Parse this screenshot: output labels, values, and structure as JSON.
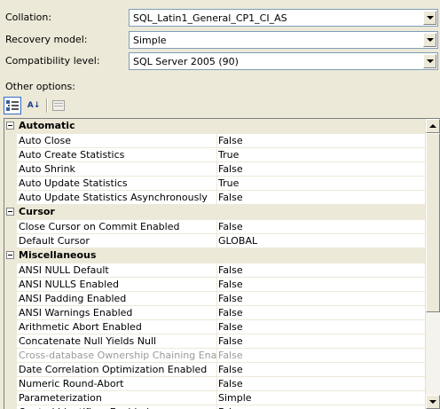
{
  "fields": {
    "collation": {
      "label": "Collation:",
      "value": "SQL_Latin1_General_CP1_CI_AS"
    },
    "recovery_model": {
      "label": "Recovery model:",
      "value": "Simple"
    },
    "compatibility_level": {
      "label": "Compatibility level:",
      "value": "SQL Server 2005 (90)"
    }
  },
  "other_options_label": "Other options:",
  "toolbar": {
    "categorized": {
      "icon": "categorized-icon"
    },
    "alphabetical": {
      "icon": "sort-az-icon",
      "glyph": "A↓"
    },
    "property_pages": {
      "icon": "property-pages-icon"
    }
  },
  "grid": {
    "categories": [
      {
        "label": "Automatic",
        "rows": [
          {
            "name": "Auto Close",
            "value": "False"
          },
          {
            "name": "Auto Create Statistics",
            "value": "True"
          },
          {
            "name": "Auto Shrink",
            "value": "False"
          },
          {
            "name": "Auto Update Statistics",
            "value": "True"
          },
          {
            "name": "Auto Update Statistics Asynchronously",
            "value": "False"
          }
        ]
      },
      {
        "label": "Cursor",
        "rows": [
          {
            "name": "Close Cursor on Commit Enabled",
            "value": "False"
          },
          {
            "name": "Default Cursor",
            "value": "GLOBAL"
          }
        ]
      },
      {
        "label": "Miscellaneous",
        "rows": [
          {
            "name": "ANSI NULL Default",
            "value": "False"
          },
          {
            "name": "ANSI NULLS Enabled",
            "value": "False"
          },
          {
            "name": "ANSI Padding Enabled",
            "value": "False"
          },
          {
            "name": "ANSI Warnings Enabled",
            "value": "False"
          },
          {
            "name": "Arithmetic Abort Enabled",
            "value": "False"
          },
          {
            "name": "Concatenate Null Yields Null",
            "value": "False"
          },
          {
            "name": "Cross-database Ownership Chaining Enabled",
            "value": "False",
            "disabled": true
          },
          {
            "name": "Date Correlation Optimization Enabled",
            "value": "False"
          },
          {
            "name": "Numeric Round-Abort",
            "value": "False"
          },
          {
            "name": "Parameterization",
            "value": "Simple"
          },
          {
            "name": "Quoted Identifiers Enabled",
            "value": "False"
          }
        ]
      }
    ]
  }
}
